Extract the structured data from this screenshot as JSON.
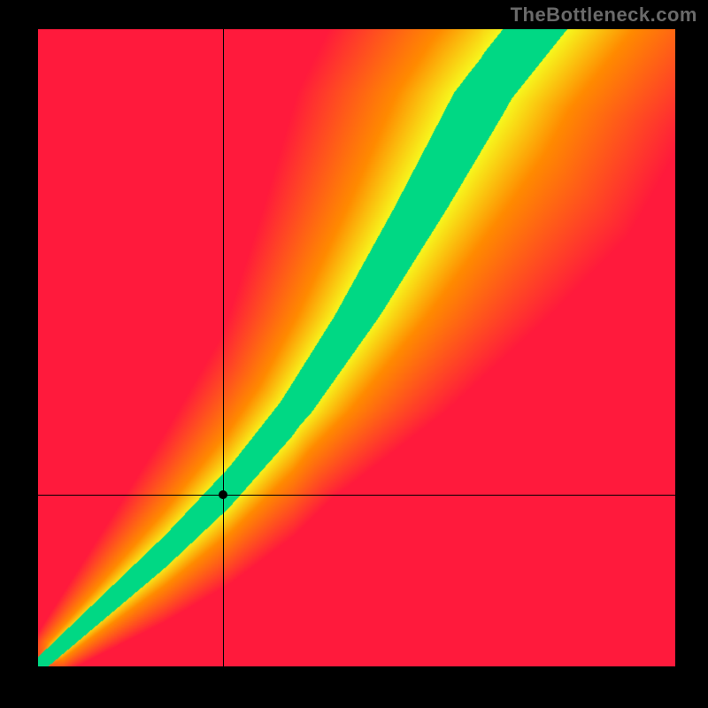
{
  "chart_data": {
    "type": "heatmap",
    "title": "",
    "attribution": "TheBottleneck.com",
    "xlabel": "",
    "ylabel": "",
    "x_range": [
      0,
      100
    ],
    "y_range": [
      0,
      100
    ],
    "marker": {
      "x": 29,
      "y": 27
    },
    "optimal_line": {
      "description": "Green optimal balance curve; roughly y = x at the low end, steepening toward y ≈ 1.5x at the top",
      "points": [
        {
          "x": 0,
          "y": 0
        },
        {
          "x": 10,
          "y": 9
        },
        {
          "x": 20,
          "y": 18
        },
        {
          "x": 30,
          "y": 28
        },
        {
          "x": 40,
          "y": 40
        },
        {
          "x": 50,
          "y": 55
        },
        {
          "x": 60,
          "y": 72
        },
        {
          "x": 70,
          "y": 90
        },
        {
          "x": 78,
          "y": 100
        }
      ]
    },
    "band_half_width": 3.5,
    "colors": {
      "optimal": "#00d884",
      "near": "#f6ff1f",
      "mid": "#ff8a00",
      "far": "#ff1a3c"
    }
  }
}
